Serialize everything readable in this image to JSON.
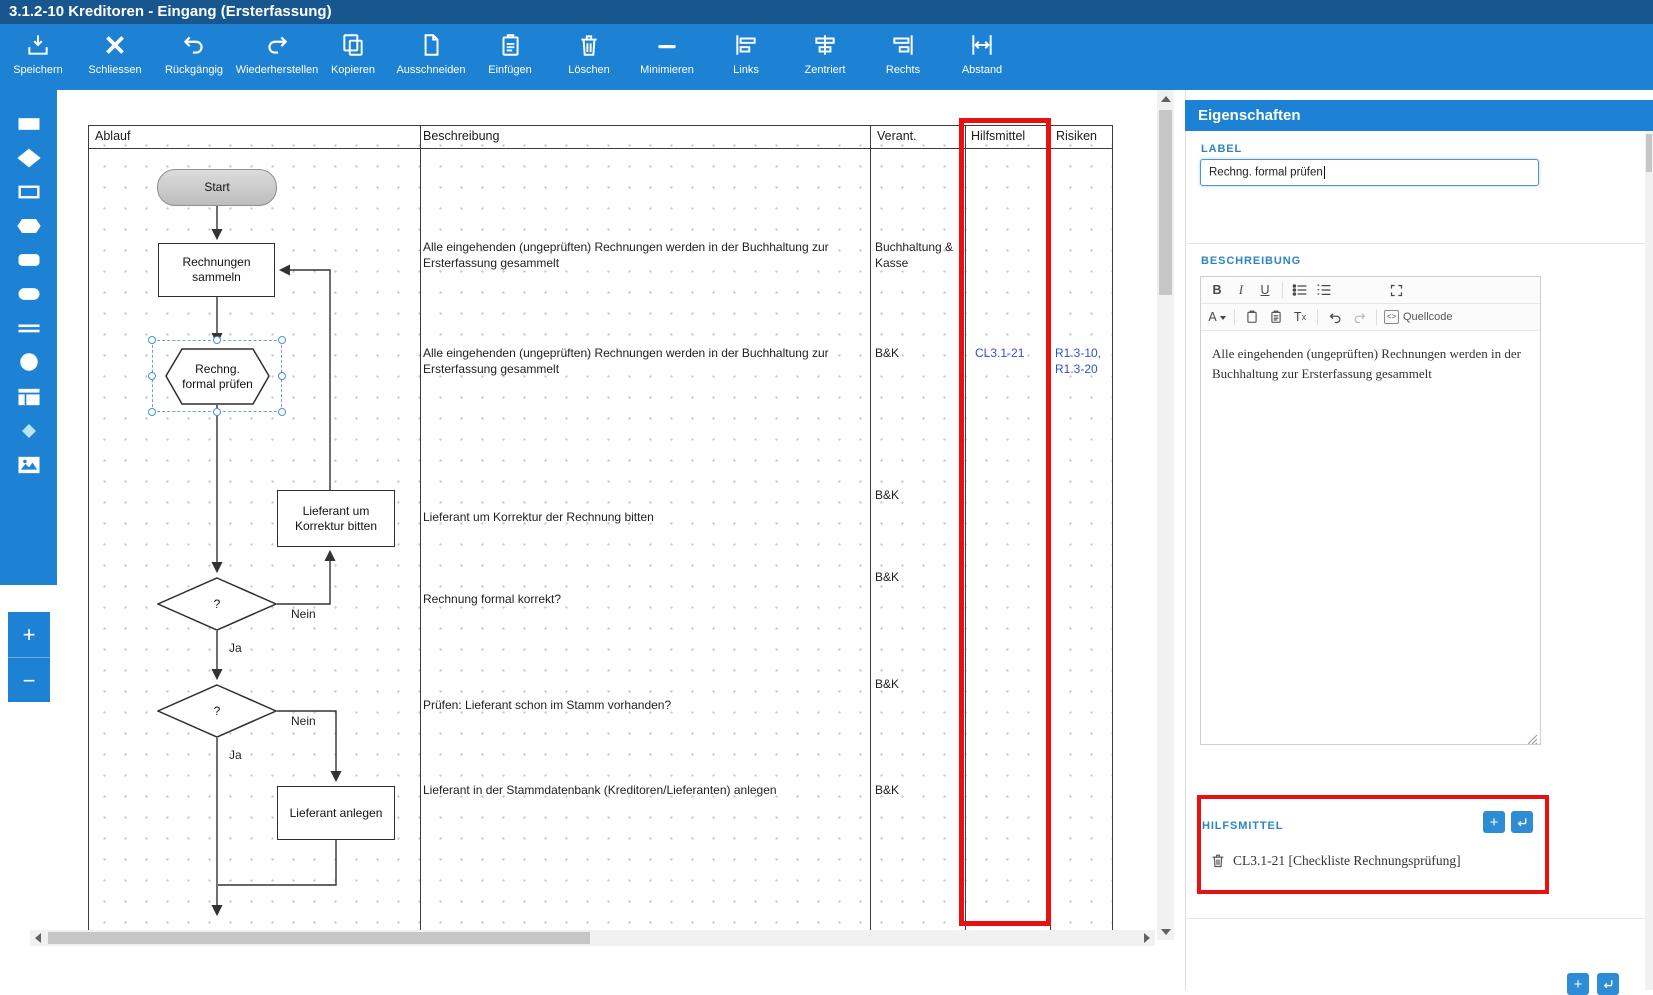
{
  "window": {
    "title": "3.1.2-10 Kreditoren - Eingang (Ersterfassung)"
  },
  "toolbar": {
    "buttons": [
      {
        "name": "speichern",
        "label": "Speichern"
      },
      {
        "name": "schliessen",
        "label": "Schliessen"
      },
      {
        "name": "rueckgaengig",
        "label": "Rückgängig"
      },
      {
        "name": "wiederherstellen",
        "label": "Wiederherstellen"
      },
      {
        "name": "kopieren",
        "label": "Kopieren"
      },
      {
        "name": "ausschneiden",
        "label": "Ausschneiden"
      },
      {
        "name": "einfuegen",
        "label": "Einfügen"
      },
      {
        "name": "loeschen",
        "label": "Löschen"
      },
      {
        "name": "minimieren",
        "label": "Minimieren"
      },
      {
        "name": "links",
        "label": "Links"
      },
      {
        "name": "zentriert",
        "label": "Zentriert"
      },
      {
        "name": "rechts",
        "label": "Rechts"
      },
      {
        "name": "abstand",
        "label": "Abstand"
      }
    ]
  },
  "palette": {
    "tools": [
      "rectangle",
      "diamond",
      "rectangle-outline",
      "hexagon",
      "rounded-rectangle",
      "stadium",
      "parallel-lines",
      "circle",
      "table",
      "small-diamond",
      "image"
    ]
  },
  "zoom_controls": {
    "zoom_in": "+",
    "zoom_out": "−"
  },
  "diagram": {
    "headers": {
      "ablauf": "Ablauf",
      "beschreibung": "Beschreibung",
      "verant": "Verant.",
      "hilfsmittel": "Hilfsmittel",
      "risiken": "Risiken"
    },
    "nodes": {
      "start": "Start",
      "sammeln": "Rechnungen sammeln",
      "pruefen": "Rechng. formal prüfen",
      "korrektur": "Lieferant um Korrektur bitten",
      "decision1": "?",
      "decision2": "?",
      "anlegen": "Lieferant anlegen"
    },
    "edge_labels": {
      "nein1": "Nein",
      "ja1": "Ja",
      "nein2": "Nein",
      "ja2": "Ja"
    },
    "rows": [
      {
        "beschreibung": "Alle eingehenden (ungeprüften) Rechnungen werden in der Buchhaltung zur Ersterfassung gesammelt",
        "verant": "Buchhaltung & Kasse"
      },
      {
        "beschreibung": "Alle eingehenden (ungeprüften) Rechnungen werden in der Buchhaltung zur Ersterfassung gesammelt",
        "verant": "B&K",
        "hilfsmittel": "CL3.1-21",
        "risiken1": "R1.3-10,",
        "risiken2": "R1.3-20"
      },
      {
        "beschreibung": "Lieferant um Korrektur der Rechnung bitten",
        "verant": "B&K"
      },
      {
        "beschreibung": "Rechnung formal korrekt?",
        "verant": "B&K"
      },
      {
        "beschreibung": "Prüfen: Lieferant schon im Stamm vorhanden?",
        "verant": "B&K"
      },
      {
        "beschreibung": "Lieferant in der Stammdatenbank (Kreditoren/Lieferanten) anlegen",
        "verant": "B&K"
      }
    ]
  },
  "properties": {
    "panel_title": "Eigenschaften",
    "label": {
      "heading": "LABEL",
      "value": "Rechng. formal prüfen"
    },
    "beschreibung": {
      "heading": "BESCHREIBUNG",
      "toolbar": {
        "bold": "B",
        "italic": "I",
        "underline": "U",
        "font_color": "A",
        "clear_format": "T",
        "clear_format_sub": "x",
        "quellcode": "Quellcode"
      },
      "content": "Alle eingehenden (ungeprüften) Rechnungen werden in der Buchhaltung zur Ersterfassung gesammelt"
    },
    "hilfsmittel": {
      "heading": "HILFSMITTEL",
      "add_label": "+",
      "items": [
        {
          "label": "CL3.1-21 [Checkliste Rechnungsprüfung]"
        }
      ]
    },
    "next_section": {
      "add_label": "+"
    }
  },
  "colors": {
    "titlebar": "#17568f",
    "toolbar_blue": "#1e82d4",
    "annotation_red": "#e81010",
    "link_blue": "#3352c5",
    "heading_blue": "#2e86c1",
    "selection_blue": "#4a90d9"
  }
}
